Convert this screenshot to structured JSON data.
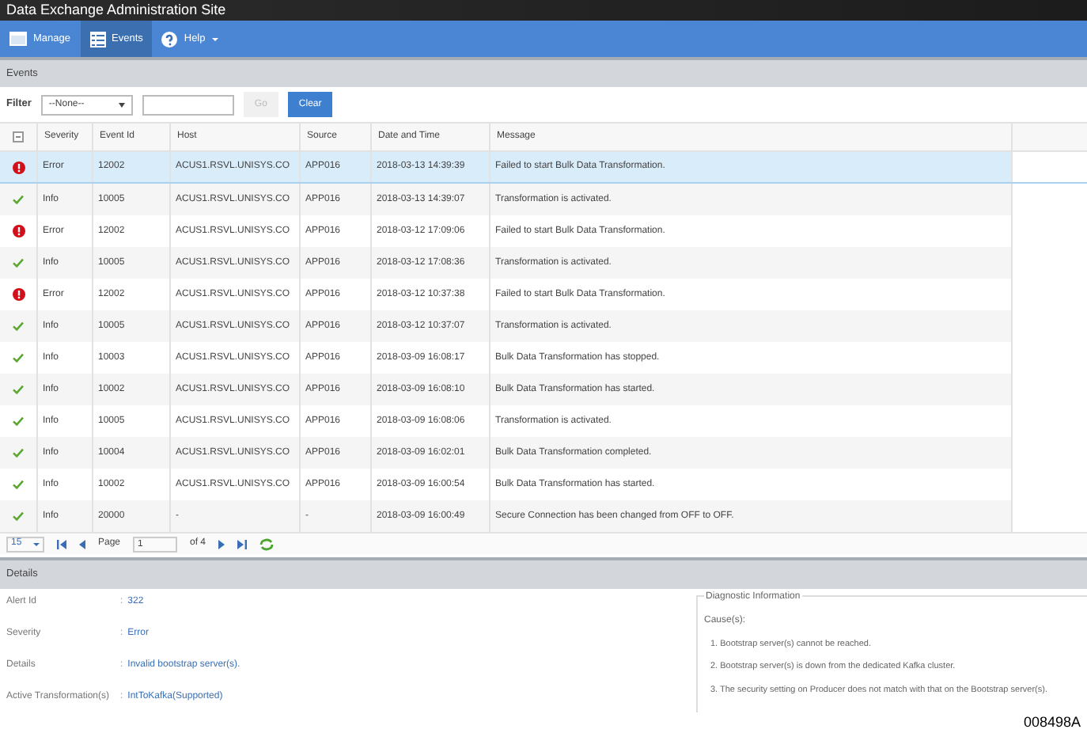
{
  "window": {
    "title": "Data Exchange Administration Site"
  },
  "nav": [
    {
      "label": "Manage",
      "selected": false,
      "dropdown": false
    },
    {
      "label": "Events",
      "selected": true,
      "dropdown": false
    },
    {
      "label": "Help",
      "selected": false,
      "dropdown": true
    }
  ],
  "panel_title": "Events",
  "filter": {
    "label": "Filter",
    "select_value": "--None--",
    "go": "Go",
    "go_disabled": true,
    "clear": "Clear"
  },
  "table": {
    "columns": [
      "Severity",
      "Event Id",
      "Host",
      "Source",
      "Date and Time",
      "Message"
    ],
    "rows": [
      {
        "kind": "error",
        "severity": "Error",
        "event_id": "12002",
        "host": "ACUS1.RSVL.UNISYS.CO",
        "source": "APP016",
        "date": "2018-03-13 14:39:39",
        "message": "Failed to start Bulk Data Transformation.",
        "selected": true
      },
      {
        "kind": "info",
        "severity": "Info",
        "event_id": "10005",
        "host": "ACUS1.RSVL.UNISYS.CO",
        "source": "APP016",
        "date": "2018-03-13 14:39:07",
        "message": "Transformation is activated.",
        "selected": false
      },
      {
        "kind": "error",
        "severity": "Error",
        "event_id": "12002",
        "host": "ACUS1.RSVL.UNISYS.CO",
        "source": "APP016",
        "date": "2018-03-12 17:09:06",
        "message": "Failed to start Bulk Data Transformation.",
        "selected": false
      },
      {
        "kind": "info",
        "severity": "Info",
        "event_id": "10005",
        "host": "ACUS1.RSVL.UNISYS.CO",
        "source": "APP016",
        "date": "2018-03-12 17:08:36",
        "message": "Transformation is activated.",
        "selected": false
      },
      {
        "kind": "error",
        "severity": "Error",
        "event_id": "12002",
        "host": "ACUS1.RSVL.UNISYS.CO",
        "source": "APP016",
        "date": "2018-03-12 10:37:38",
        "message": "Failed to start Bulk Data Transformation.",
        "selected": false
      },
      {
        "kind": "info",
        "severity": "Info",
        "event_id": "10005",
        "host": "ACUS1.RSVL.UNISYS.CO",
        "source": "APP016",
        "date": "2018-03-12 10:37:07",
        "message": "Transformation is activated.",
        "selected": false
      },
      {
        "kind": "info",
        "severity": "Info",
        "event_id": "10003",
        "host": "ACUS1.RSVL.UNISYS.CO",
        "source": "APP016",
        "date": "2018-03-09 16:08:17",
        "message": "Bulk Data Transformation has stopped.",
        "selected": false
      },
      {
        "kind": "info",
        "severity": "Info",
        "event_id": "10002",
        "host": "ACUS1.RSVL.UNISYS.CO",
        "source": "APP016",
        "date": "2018-03-09 16:08:10",
        "message": "Bulk Data Transformation has started.",
        "selected": false
      },
      {
        "kind": "info",
        "severity": "Info",
        "event_id": "10005",
        "host": "ACUS1.RSVL.UNISYS.CO",
        "source": "APP016",
        "date": "2018-03-09 16:08:06",
        "message": "Transformation is activated.",
        "selected": false
      },
      {
        "kind": "info",
        "severity": "Info",
        "event_id": "10004",
        "host": "ACUS1.RSVL.UNISYS.CO",
        "source": "APP016",
        "date": "2018-03-09 16:02:01",
        "message": "Bulk Data Transformation completed.",
        "selected": false
      },
      {
        "kind": "info",
        "severity": "Info",
        "event_id": "10002",
        "host": "ACUS1.RSVL.UNISYS.CO",
        "source": "APP016",
        "date": "2018-03-09 16:00:54",
        "message": "Bulk Data Transformation has started.",
        "selected": false
      },
      {
        "kind": "info",
        "severity": "Info",
        "event_id": "20000",
        "host": "-",
        "source": "-",
        "date": "2018-03-09 16:00:49",
        "message": "Secure Connection has been changed from OFF to OFF.",
        "selected": false
      }
    ]
  },
  "pager": {
    "page_size": "15",
    "page_label": "Page",
    "page": "1",
    "of": "of 4"
  },
  "details": {
    "title": "Details",
    "fields": [
      {
        "label": "Alert Id",
        "separator": ":",
        "value": "322"
      },
      {
        "label": "Severity",
        "separator": ":",
        "value": "Error"
      },
      {
        "label": "Details",
        "separator": ":",
        "value": "Invalid bootstrap server(s)."
      },
      {
        "label": "Active Transformation(s)",
        "separator": ":",
        "value": "IntToKafka(Supported)"
      }
    ],
    "diagnostic": {
      "title": "Diagnostic Information",
      "causes_label": "Cause(s):",
      "causes": [
        "1. Bootstrap server(s) cannot be reached.",
        "2. Bootstrap server(s) is down from the dedicated Kafka cluster.",
        "3. The security setting on Producer does not match with that on the Bootstrap server(s)."
      ]
    }
  },
  "figure_id": "008498A"
}
